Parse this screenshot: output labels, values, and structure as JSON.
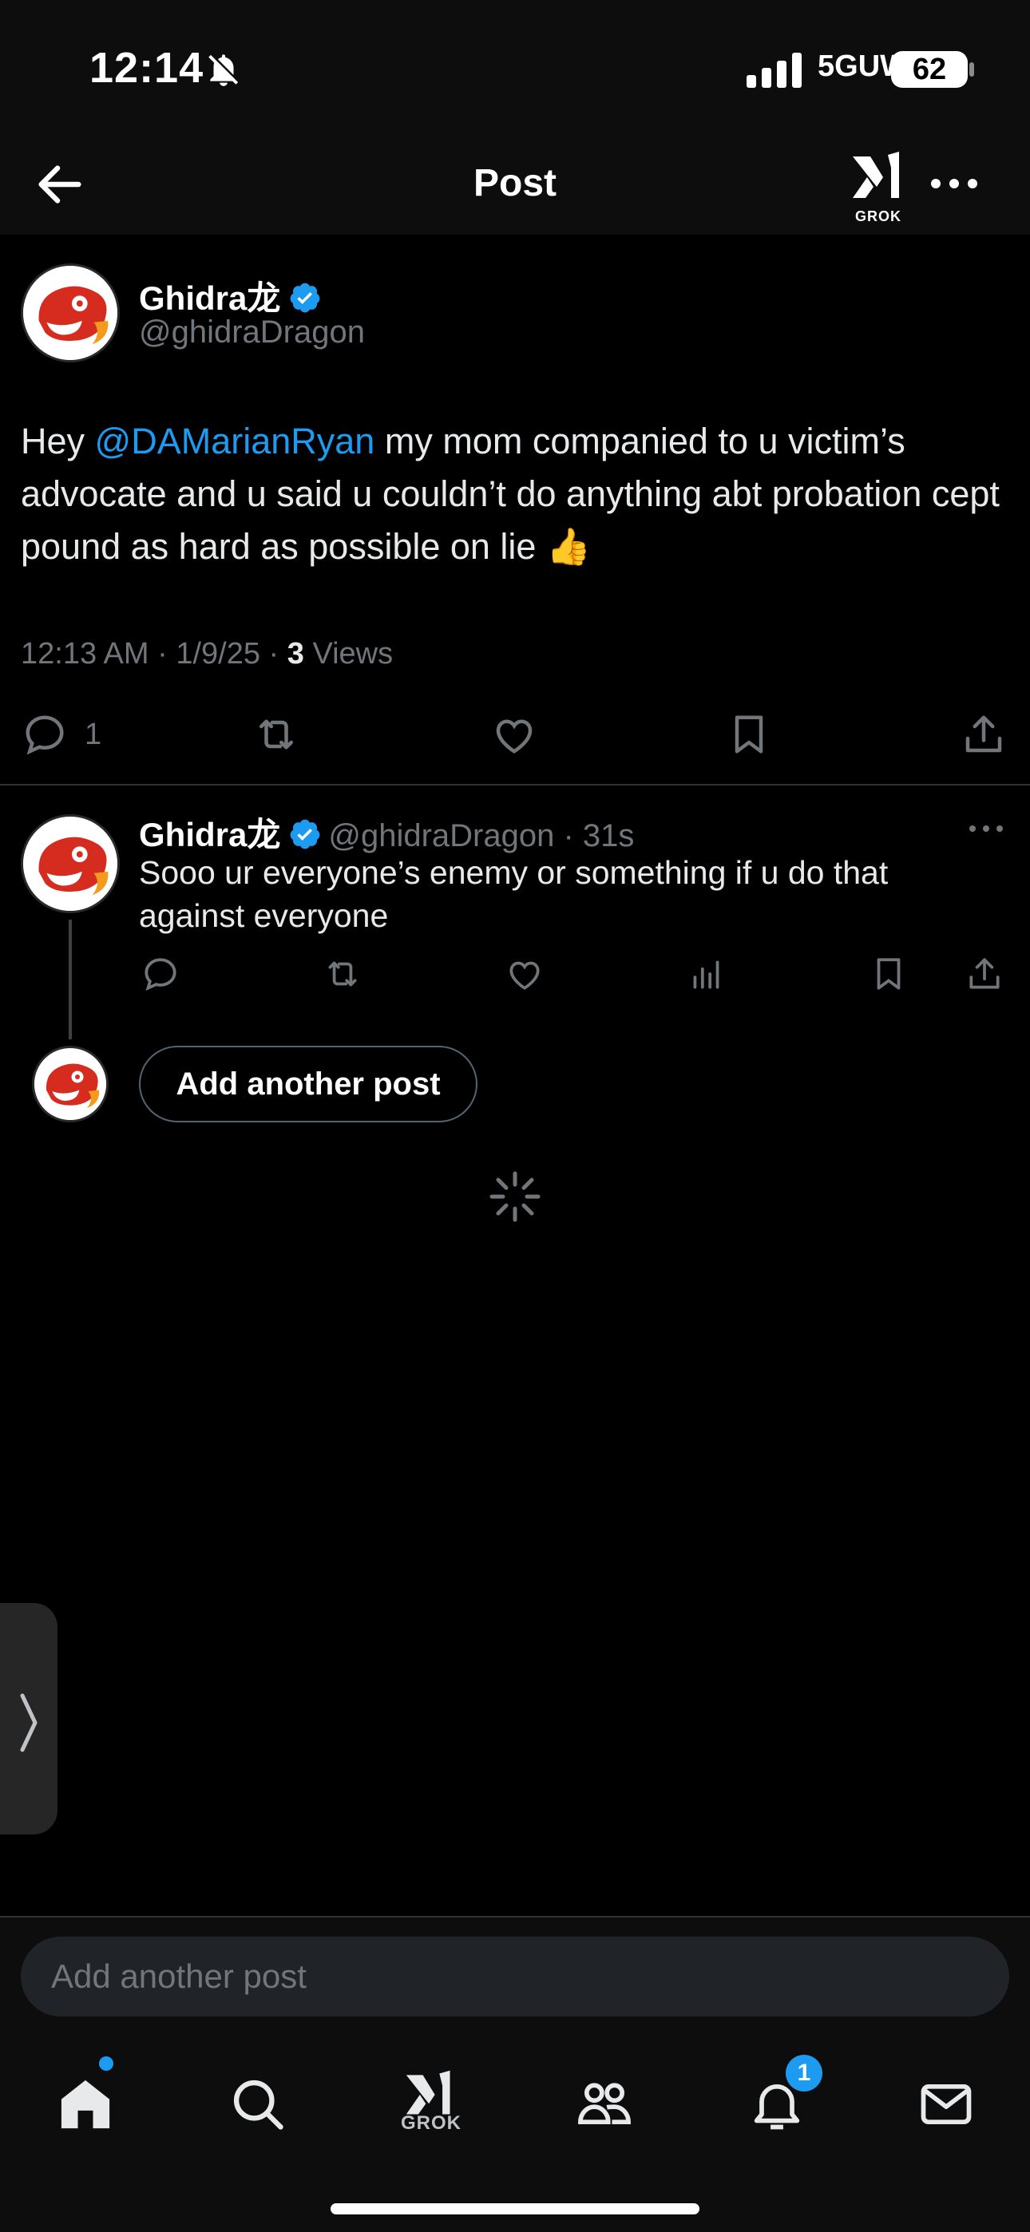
{
  "status_bar": {
    "time": "12:14",
    "network": "5GUW",
    "battery": "62"
  },
  "header": {
    "title": "Post",
    "grok_label": "GROK"
  },
  "post": {
    "author_name": "Ghidra龙",
    "author_handle": "@ghidraDragon",
    "text_prefix": "Hey ",
    "mention": "@DAMarianRyan",
    "text_suffix": " my mom companied to u victim’s advocate and u said u couldn’t do anything abt probation cept pound as hard as possible on lie 👍",
    "timestamp": "12:13 AM · 1/9/25 · ",
    "views_count": "3",
    "views_label": " Views",
    "reply_count": "1"
  },
  "reply": {
    "author_name": "Ghidra龙",
    "handle_time": "@ghidraDragon · 31s",
    "text": "Sooo ur everyone’s enemy or something if u do that against everyone"
  },
  "thread": {
    "add_button_label": "Add another post"
  },
  "compose": {
    "placeholder": "Add another post"
  },
  "tab_bar": {
    "grok_label": "GROK",
    "notification_badge": "1"
  },
  "colors": {
    "accent": "#1d9bf0",
    "background": "#000000",
    "muted": "#71767b"
  }
}
